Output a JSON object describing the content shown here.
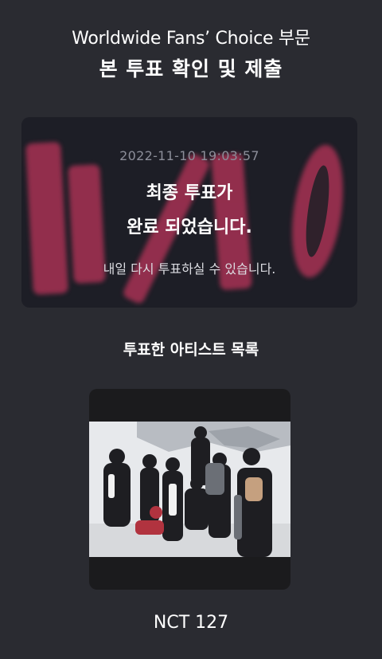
{
  "header": {
    "title": "Worldwide Fans’ Choice 부문",
    "subtitle": "본 투표 확인 및 제출"
  },
  "vote_result": {
    "watermark_text": "11/10",
    "timestamp": "2022-11-10 19:03:57",
    "complete_line1": "최종 투표가",
    "complete_line2": "완료 되었습니다.",
    "revote_message": "내일 다시 투표하실 수 있습니다."
  },
  "artists_section": {
    "title": "투표한 아티스트 목록",
    "artists": [
      {
        "name": "NCT 127"
      }
    ]
  },
  "colors": {
    "background": "#2a2b31",
    "card": "#1d1e26",
    "watermark": "#c0365c",
    "timestamp": "#8c8e99"
  }
}
